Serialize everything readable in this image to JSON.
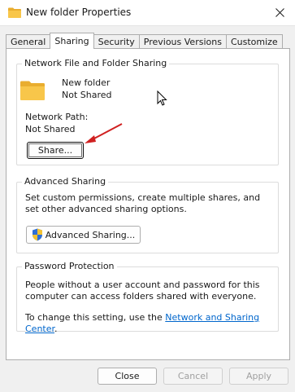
{
  "window": {
    "title": "New folder Properties"
  },
  "tabs": [
    {
      "label": "General"
    },
    {
      "label": "Sharing"
    },
    {
      "label": "Security"
    },
    {
      "label": "Previous Versions"
    },
    {
      "label": "Customize"
    }
  ],
  "network_sharing": {
    "group_title": "Network File and Folder Sharing",
    "folder_name": "New folder",
    "folder_status": "Not Shared",
    "path_label": "Network Path:",
    "path_value": "Not Shared",
    "share_button": "Share..."
  },
  "advanced_sharing": {
    "group_title": "Advanced Sharing",
    "description": "Set custom permissions, create multiple shares, and set other advanced sharing options.",
    "button": "Advanced Sharing..."
  },
  "password_protection": {
    "group_title": "Password Protection",
    "description": "People without a user account and password for this computer can access folders shared with everyone.",
    "change_prefix": "To change this setting, use the ",
    "link_text": "Network and Sharing Center",
    "change_suffix": "."
  },
  "footer": {
    "close": "Close",
    "cancel": "Cancel",
    "apply": "Apply"
  },
  "colors": {
    "folder": "#f8c64a",
    "arrow": "#d02020",
    "link": "#0066cc"
  }
}
